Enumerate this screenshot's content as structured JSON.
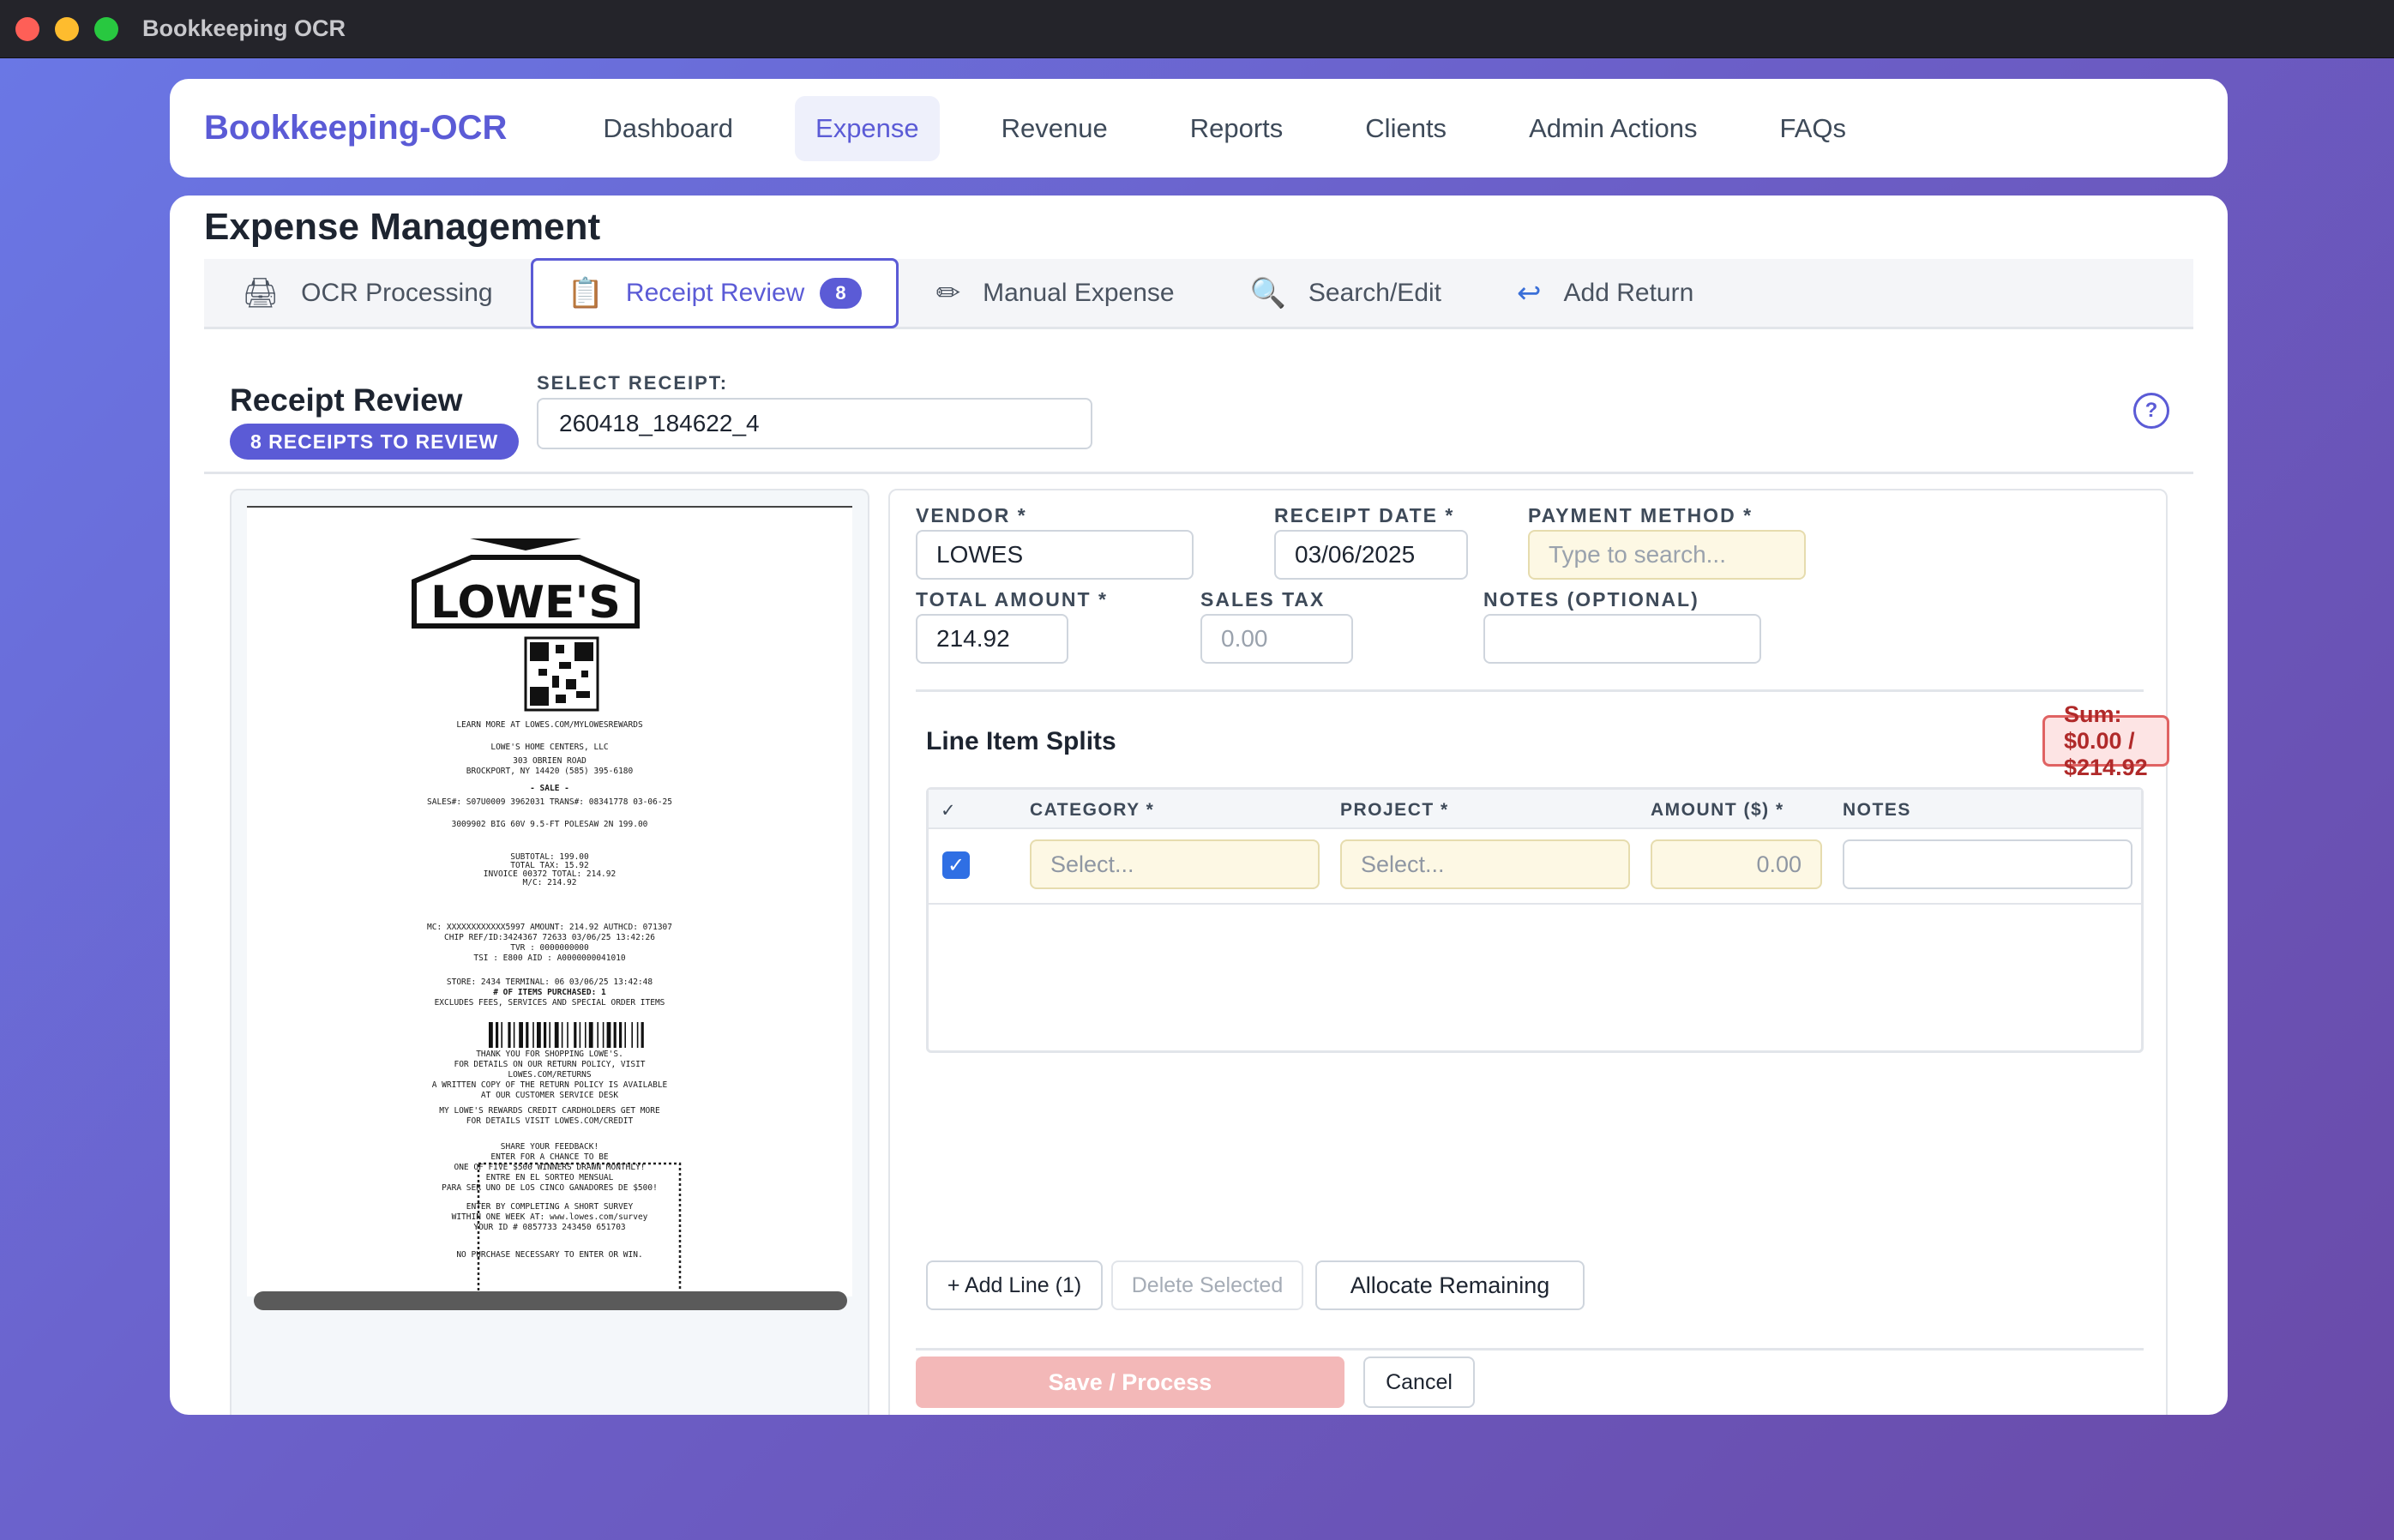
{
  "window": {
    "title": "Bookkeeping OCR"
  },
  "nav": {
    "brand": "Bookkeeping-OCR",
    "items": [
      {
        "label": "Dashboard"
      },
      {
        "label": "Expense"
      },
      {
        "label": "Revenue"
      },
      {
        "label": "Reports"
      },
      {
        "label": "Clients"
      },
      {
        "label": "Admin Actions"
      },
      {
        "label": "FAQs"
      }
    ],
    "active": "Expense"
  },
  "page": {
    "title": "Expense Management"
  },
  "tabs": [
    {
      "icon": "printer-icon",
      "glyph": "🖨",
      "label": "OCR Processing"
    },
    {
      "icon": "clipboard-icon",
      "glyph": "📋",
      "label": "Receipt Review",
      "badge": "8"
    },
    {
      "icon": "pencil-icon",
      "glyph": "✏",
      "label": "Manual Expense"
    },
    {
      "icon": "magnifier-icon",
      "glyph": "🔍",
      "label": "Search/Edit"
    },
    {
      "icon": "return-arrow-icon",
      "glyph": "↩",
      "label": "Add Return"
    }
  ],
  "review": {
    "title": "Receipt Review",
    "badge": "8 RECEIPTS TO REVIEW",
    "select_label": "SELECT RECEIPT:",
    "select_value": "260418_184622_4",
    "help": "?"
  },
  "receipt_image": {
    "store": "LOWE'S",
    "lines": [
      "LEARN MORE AT LOWES.COM/MYLOWESREWARDS",
      "LOWE'S HOME CENTERS, LLC",
      "303 OBRIEN ROAD",
      "BROCKPORT, NY 14420   (585) 395-6180",
      "- SALE -",
      "SALES#: S07U0009  3962031  TRANS#: 08341778  03-06-25",
      "3009902  BIG 60V 9.5-FT POLESAW  2N     199.00",
      "SUBTOTAL:   199.00",
      "TOTAL TAX:   15.92",
      "INVOICE 00372 TOTAL:  214.92",
      "M/C:   214.92",
      "MC: XXXXXXXXXXXX5997  AMOUNT: 214.92  AUTHCD: 071307",
      "CHIP REF/ID:3424367 72633  03/06/25 13:42:26",
      "TVR : 0000000000",
      "TSI : E800  AID : A0000000041010",
      "STORE: 2434  TERMINAL: 06  03/06/25 13:42:48",
      "# OF ITEMS PURCHASED:   1",
      "EXCLUDES FEES, SERVICES AND SPECIAL ORDER ITEMS",
      "THANK YOU FOR SHOPPING LOWE'S.",
      "FOR DETAILS ON OUR RETURN POLICY, VISIT",
      "LOWES.COM/RETURNS",
      "A WRITTEN COPY OF THE RETURN POLICY IS AVAILABLE",
      "AT OUR CUSTOMER SERVICE DESK",
      "MY LOWE'S REWARDS CREDIT CARDHOLDERS GET MORE",
      "FOR DETAILS VISIT LOWES.COM/CREDIT",
      "SHARE YOUR FEEDBACK!",
      "ENTER FOR A CHANCE TO BE",
      "ONE OF FIVE $500 WINNERS DRAWN MONTHLY!",
      "ENTRE EN EL SORTEO MENSUAL",
      "PARA SER UNO DE LOS CINCO GANADORES DE $500!",
      "ENTER BY COMPLETING A SHORT SURVEY",
      "WITHIN ONE WEEK AT: www.lowes.com/survey",
      "YOUR ID #  0857733 243450 651703",
      "NO PURCHASE NECESSARY TO ENTER OR WIN."
    ]
  },
  "form": {
    "vendor": {
      "label": "VENDOR *",
      "value": "LOWES"
    },
    "receipt_date": {
      "label": "RECEIPT DATE *",
      "value": "03/06/2025"
    },
    "payment_method": {
      "label": "PAYMENT METHOD *",
      "placeholder": "Type to search..."
    },
    "total_amount": {
      "label": "TOTAL AMOUNT *",
      "value": "214.92"
    },
    "sales_tax": {
      "label": "SALES TAX",
      "placeholder": "0.00"
    },
    "notes": {
      "label": "NOTES (OPTIONAL)",
      "value": ""
    }
  },
  "line_items": {
    "title": "Line Item Splits",
    "sum": "Sum: $0.00 / $214.92",
    "columns": [
      "✓",
      "CATEGORY *",
      "PROJECT *",
      "AMOUNT ($) *",
      "NOTES"
    ],
    "rows": [
      {
        "checked": true,
        "category_placeholder": "Select...",
        "project_placeholder": "Select...",
        "amount_placeholder": "0.00",
        "notes": ""
      }
    ],
    "add_line": "+ Add Line (1)",
    "delete_selected": "Delete Selected",
    "allocate_remaining": "Allocate Remaining"
  },
  "actions": {
    "save": "Save / Process",
    "cancel": "Cancel"
  },
  "colors": {
    "accent": "#5b5bd6",
    "sum_error_bg": "#fde4e4",
    "sum_error_border": "#e06363",
    "required_field_bg": "#fdf8e4",
    "save_disabled": "#f3b8b8"
  }
}
